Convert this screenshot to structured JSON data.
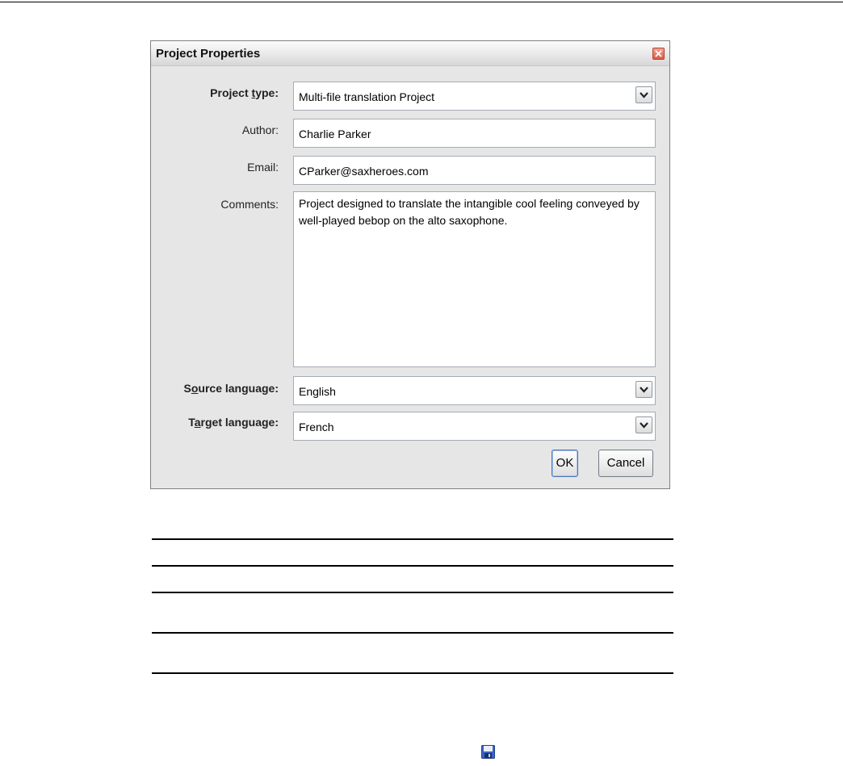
{
  "dialog": {
    "title": "Project Properties",
    "fields": {
      "project_type": {
        "label_before": "Project ",
        "label_accel": "t",
        "label_after": "ype:",
        "value": "Multi-file translation Project"
      },
      "author": {
        "label": "Author:",
        "value": "Charlie Parker"
      },
      "email": {
        "label": "Email:",
        "value": "CParker@saxheroes.com"
      },
      "comments": {
        "label": "Comments:",
        "value": "Project designed to translate the intangible cool feeling conveyed by well-played bebop on the alto saxophone."
      },
      "source_language": {
        "label_before": "S",
        "label_accel": "o",
        "label_after": "urce language:",
        "value": "English"
      },
      "target_language": {
        "label_before": "T",
        "label_accel": "a",
        "label_after": "rget language:",
        "value": "French"
      }
    },
    "buttons": {
      "ok": "OK",
      "cancel": "Cancel"
    }
  },
  "icons": {
    "close": "close-icon",
    "dropdown": "chevron-down-icon",
    "save": "save-icon"
  },
  "colors": {
    "dialog_bg": "#e6e6e6",
    "close_button": "#dd5a48"
  }
}
